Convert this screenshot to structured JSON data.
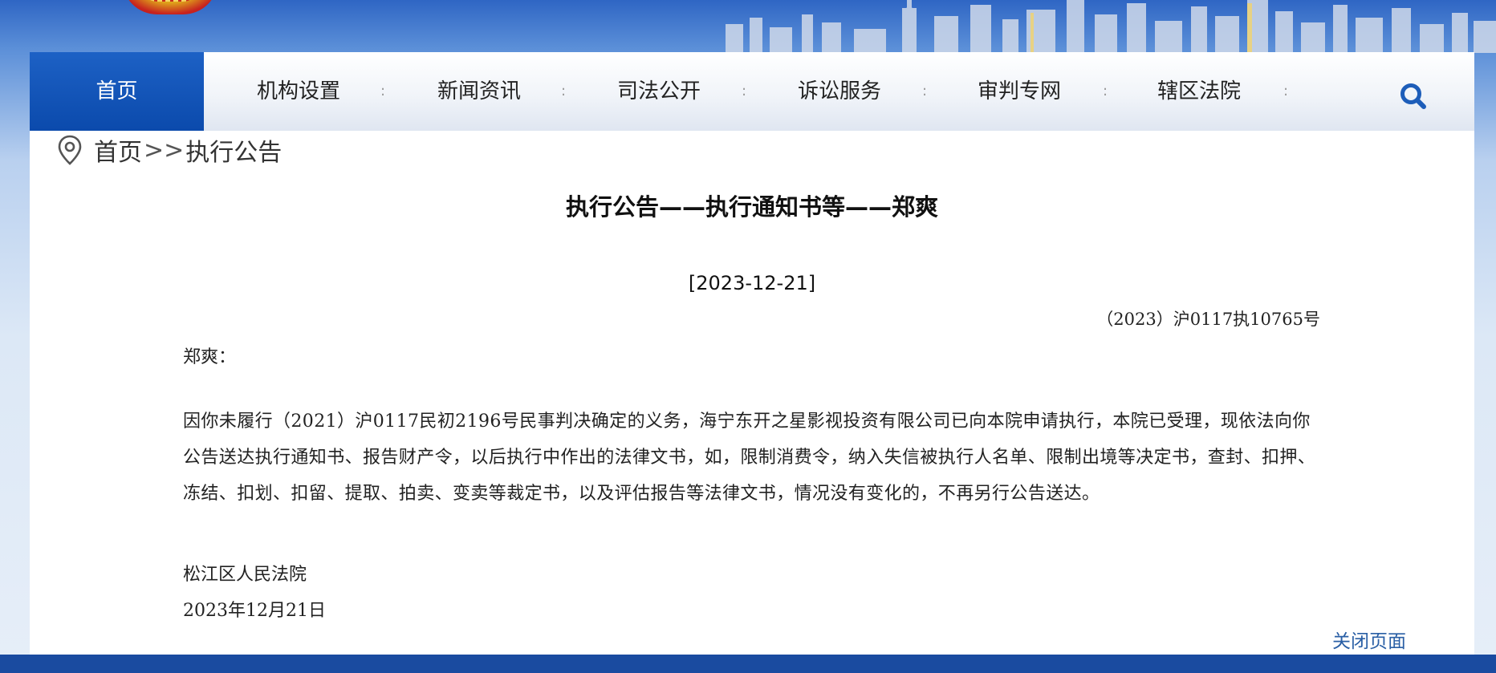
{
  "nav": {
    "home": "首页",
    "items": [
      "机构设置",
      "新闻资讯",
      "司法公开",
      "诉讼服务",
      "审判专网",
      "辖区法院"
    ],
    "separator": ":"
  },
  "breadcrumb": {
    "home": "首页",
    "separator": ">>",
    "current": "执行公告"
  },
  "article": {
    "title": "执行公告——执行通知书等——郑爽",
    "date": "[2023-12-21]",
    "case_no": "（2023）沪0117执10765号",
    "addressee": "郑爽：",
    "body": "因你未履行（2021）沪0117民初2196号民事判决确定的义务，海宁东开之星影视投资有限公司已向本院申请执行，本院已受理，现依法向你公告送达执行通知书、报告财产令，以后执行中作出的法律文书，如，限制消费令，纳入失信被执行人名单、限制出境等决定书，查封、扣押、冻结、扣划、扣留、提取、拍卖、变卖等裁定书，以及评估报告等法律文书，情况没有变化的，不再另行公告送达。",
    "signature_org": "松江区人民法院",
    "signature_date": "2023年12月21日"
  },
  "close_link": "关闭页面",
  "icons": {
    "search": "search-icon",
    "location": "location-pin-icon",
    "emblem": "court-emblem-icon"
  },
  "colors": {
    "nav_active": "#0b4aac",
    "link": "#2a5fa5",
    "footer": "#1a4ba0"
  }
}
